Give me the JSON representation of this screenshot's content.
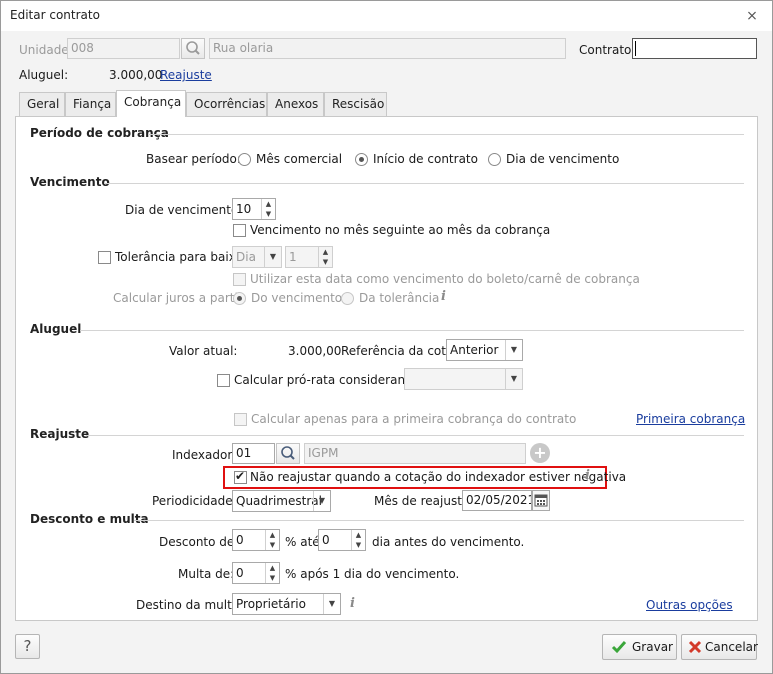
{
  "window": {
    "title": "Editar contrato",
    "close": "⨯"
  },
  "header": {
    "unidade_label": "Unidade:",
    "unidade_value": "008",
    "endereco_value": "Rua olaria",
    "contrato_label": "Contrato:",
    "contrato_value": "",
    "aluguel_label": "Aluguel:",
    "aluguel_value": "3.000,00",
    "reajuste_link": "Reajuste"
  },
  "tabs": [
    "Geral",
    "Fiança",
    "Cobrança",
    "Ocorrências",
    "Anexos",
    "Rescisão"
  ],
  "active_tab": "Cobrança",
  "periodo": {
    "title": "Período de cobrança",
    "basear_label": "Basear período:",
    "options": [
      "Mês comercial",
      "Início de contrato",
      "Dia de vencimento"
    ],
    "selected": "Início de contrato"
  },
  "vencimento": {
    "title": "Vencimento",
    "dia_label": "Dia de vencimento:",
    "dia_value": "10",
    "mes_seguinte_label": "Vencimento no mês seguinte ao mês da cobrança",
    "tolerancia_label": "Tolerância para baixa:",
    "tolerancia_unit": "Dia",
    "tolerancia_value": "1",
    "utilizar_label": "Utilizar esta data como vencimento do boleto/carnê de cobrança",
    "juros_label": "Calcular juros a partir:",
    "juros_options": [
      "Do vencimento",
      "Da tolerância"
    ]
  },
  "aluguel": {
    "title": "Aluguel",
    "valor_label": "Valor atual:",
    "valor_value": "3.000,00",
    "referencia_label": "Referência da cota:",
    "referencia_value": "Anterior",
    "prorata_label": "Calcular pró-rata considerando:",
    "prorata_value": "",
    "primeira_label": "Calcular apenas para a primeira cobrança do contrato",
    "primeira_link": "Primeira cobrança"
  },
  "reajuste": {
    "title": "Reajuste",
    "indexador_label": "Indexador:",
    "indexador_code": "01",
    "indexador_name": "IGPM",
    "nao_reajustar_label": "Não reajustar quando a cotação do indexador estiver negativa",
    "nao_reajustar_checked": true,
    "periodicidade_label": "Periodicidade:",
    "periodicidade_value": "Quadrimestral",
    "mes_label": "Mês de reajuste:",
    "mes_value": "02/05/2021"
  },
  "desconto": {
    "title": "Desconto e multa",
    "desconto_label": "Desconto de:",
    "desconto_value": "0",
    "ate_label": "% até",
    "ate_value": "0",
    "dias_label": "dia antes do vencimento.",
    "multa_label": "Multa de:",
    "multa_value": "0",
    "multa_suffix": "% após 1 dia do vencimento.",
    "destino_label": "Destino da multa:",
    "destino_value": "Proprietário",
    "outras_link": "Outras opções"
  },
  "footer": {
    "help": "?",
    "save": "Gravar",
    "cancel": "Cancelar"
  },
  "icons": {
    "info": "i",
    "search": "search-icon",
    "plus": "plus-icon",
    "calendar": "calendar-icon"
  },
  "colors": {
    "accent_link": "#1a3d9e",
    "highlight": "#e01010",
    "save_check": "#3aa63a",
    "cancel_x": "#d33a2a"
  }
}
